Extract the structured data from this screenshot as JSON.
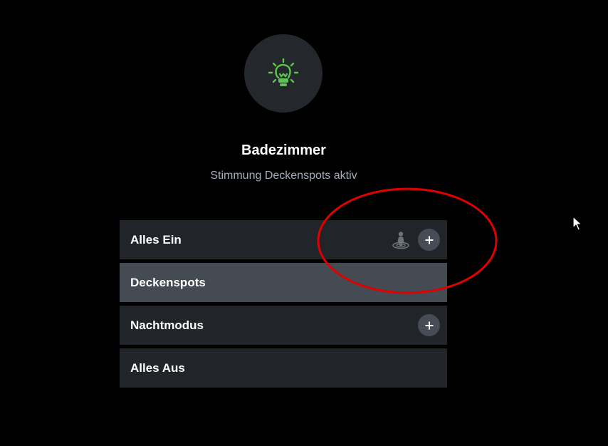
{
  "room": {
    "icon": "lightbulb-icon",
    "icon_color": "#5cc44f",
    "title": "Badezimmer",
    "status": "Stimmung Deckenspots aktiv"
  },
  "scenes": [
    {
      "label": "Alles Ein",
      "active": false,
      "presence_icon": true,
      "add_button": true
    },
    {
      "label": "Deckenspots",
      "active": true,
      "presence_icon": false,
      "add_button": false
    },
    {
      "label": "Nachtmodus",
      "active": false,
      "presence_icon": false,
      "add_button": true
    },
    {
      "label": "Alles Aus",
      "active": false,
      "presence_icon": false,
      "add_button": false
    }
  ],
  "colors": {
    "background": "#000000",
    "row": "#212428",
    "row_active": "#454b53",
    "annotation": "#e00000"
  }
}
